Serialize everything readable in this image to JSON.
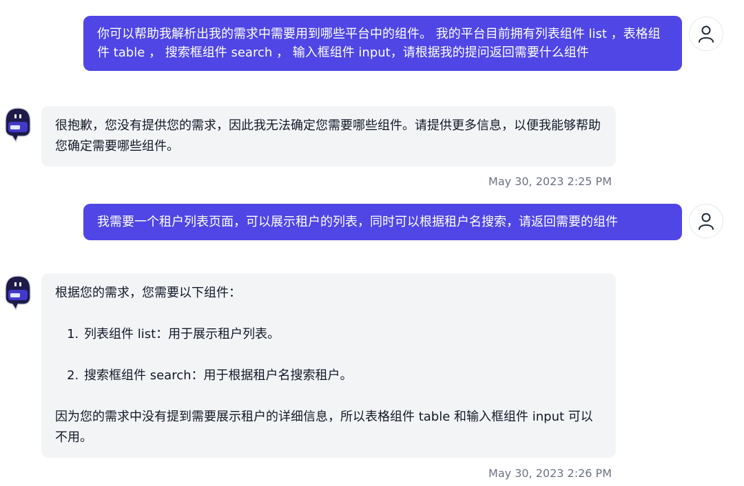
{
  "messages": [
    {
      "role": "user",
      "text": "你可以帮助我解析出我的需求中需要用到哪些平台中的组件。 我的平台目前拥有列表组件 list ，表格组件 table ， 搜索框组件 search ， 输入框组件 input，请根据我的提问返回需要什么组件"
    },
    {
      "role": "assistant",
      "text": "很抱歉，您没有提供您的需求，因此我无法确定您需要哪些组件。请提供更多信息，以便我能够帮助您确定需要哪些组件。",
      "timestamp": "May 30, 2023 2:25 PM"
    },
    {
      "role": "user",
      "text": "我需要一个租户列表页面，可以展示租户的列表，同时可以根据租户名搜索，请返回需要的组件"
    },
    {
      "role": "assistant",
      "intro": "根据您的需求，您需要以下组件：",
      "list": [
        "列表组件 list：用于展示租户列表。",
        "搜索框组件 search：用于根据租户名搜索租户。"
      ],
      "outro": "因为您的需求中没有提到需要展示租户的详细信息，所以表格组件 table 和输入框组件 input 可以不用。",
      "timestamp": "May 30, 2023 2:26 PM"
    }
  ],
  "icons": {
    "user_avatar": "user-icon",
    "bot_avatar": "robot-icon"
  },
  "colors": {
    "user_bubble": "#4f46e5",
    "bot_bubble": "#f3f4f6",
    "timestamp": "#6b7280"
  }
}
